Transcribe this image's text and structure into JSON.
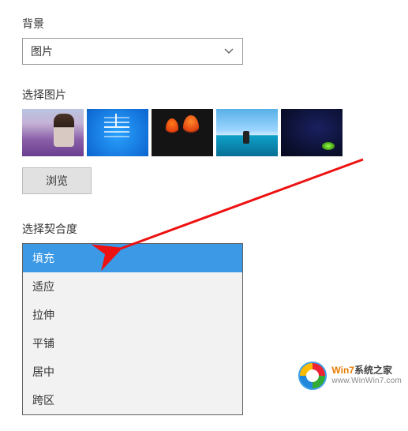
{
  "background": {
    "label": "背景",
    "selected": "图片"
  },
  "picture": {
    "label": "选择图片",
    "browse": "浏览"
  },
  "fit": {
    "label": "选择契合度",
    "options": [
      {
        "label": "填充",
        "selected": true
      },
      {
        "label": "适应",
        "selected": false
      },
      {
        "label": "拉伸",
        "selected": false
      },
      {
        "label": "平铺",
        "selected": false
      },
      {
        "label": "居中",
        "selected": false
      },
      {
        "label": "跨区",
        "selected": false
      }
    ]
  },
  "watermark": {
    "line1_prefix": "Win7",
    "line1_suffix": "系统之家",
    "line2": "www.WinWin7.com"
  },
  "thumbnails": [
    {
      "name": "wallpaper-girl-lavender"
    },
    {
      "name": "wallpaper-windows-default"
    },
    {
      "name": "wallpaper-tulips-dark"
    },
    {
      "name": "wallpaper-beach-person"
    },
    {
      "name": "wallpaper-night-tent"
    }
  ]
}
